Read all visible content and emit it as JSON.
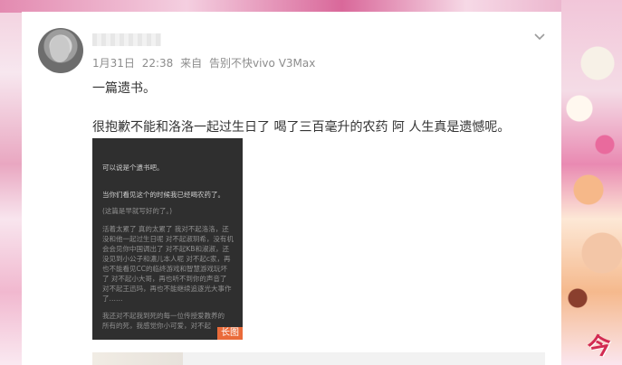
{
  "post": {
    "username": "",
    "date": "1月31日",
    "time": "22:38",
    "source_prefix": "来自",
    "source_device": "告别不快vivo V3Max",
    "title_line": "一篇遗书。",
    "body_line": "很抱歉不能和洛洛一起过生日了 喝了三百毫升的农药 阿 人生真是遗憾呢。",
    "image_tag": "长图"
  },
  "image_text": {
    "l1": "可以说是个遗书吧。",
    "l2": "当你们看见这个的时候我已经喝农药了。",
    "l3": "(这篇是早就写好的了。)",
    "l4": "活着太累了 真的太累了 我对不起洛洛，还",
    "l5": "没和他一起过生日呢 对不起淑玥希，没有机",
    "l6": "会会见你中国调出了 对不起KB和淑淑，还",
    "l7": "没见到小公子和濃儿本人呢 对不起c家，再",
    "l8": "也不能看见CC的临终游戏和智慧游戏玩坏",
    "l9": "了 对不起小大哥，再也听不到你的声音了",
    "l10": "对不起王迅玛，再也不能继续追逐光大事作",
    "l11": "了……",
    "l12": "我还对不起我到死的每一位传授爱教养的",
    "l13": "所有的死，我感觉你小可爱，对不起"
  },
  "watermark": "今",
  "icons": [
    "chevron-down-icon"
  ]
}
